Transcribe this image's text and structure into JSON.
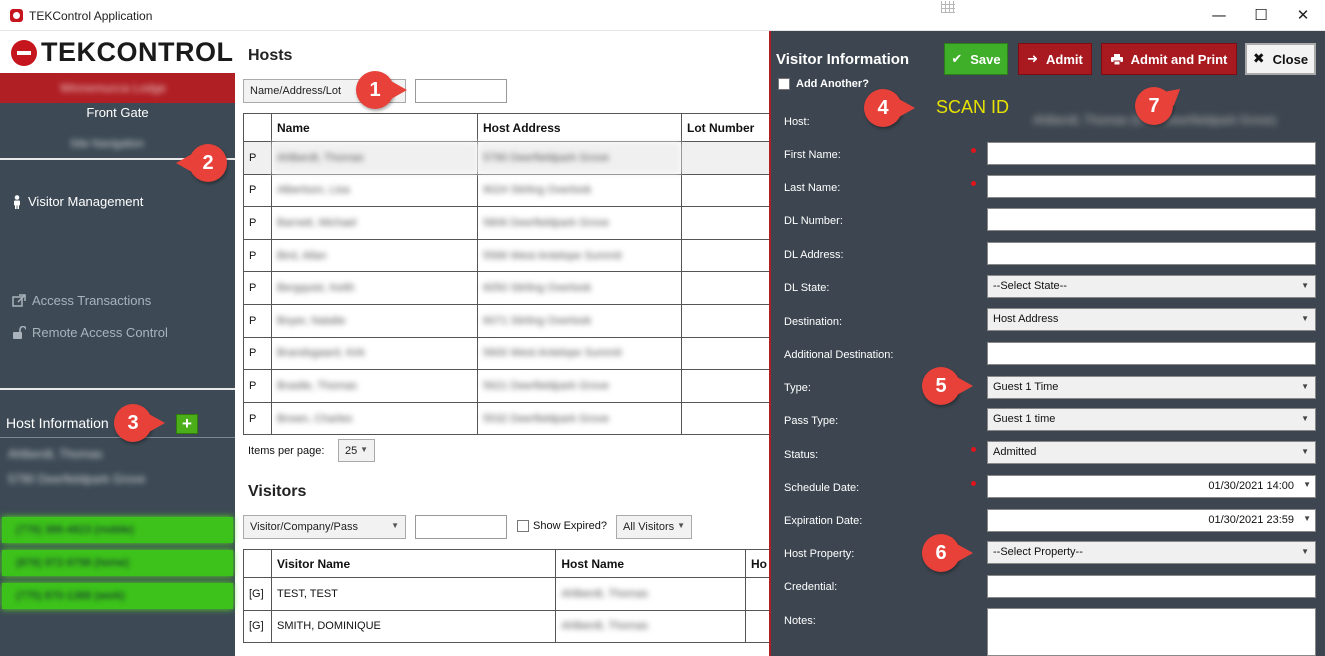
{
  "window": {
    "title": "TEKControl Application",
    "minimize": "—",
    "maximize": "☐",
    "close": "✕"
  },
  "sidebar": {
    "logo": "TEKCONTROL",
    "user_name": "Winnemucca Lodge",
    "location": "Front Gate",
    "sub_location": "Site Navigation",
    "nav": {
      "visitor_management": "Visitor Management",
      "access_transactions": "Access Transactions",
      "remote_access_control": "Remote Access Control"
    },
    "host_information": "Host Information",
    "host_name": "Ahlberdt, Thomas",
    "host_address": "5790 Deerfieldpark Grove",
    "phones": [
      "(776) 386-4823 (mobile)",
      "(876) 972-9798 (home)",
      "(775) 870-1388 (work)"
    ]
  },
  "hosts": {
    "title": "Hosts",
    "filter": "Name/Address/Lot",
    "filter_value": "",
    "columns": [
      "",
      "Name",
      "Host Address",
      "Lot Number"
    ],
    "rows": [
      {
        "type": "P",
        "name": "Ahlberdt, Thomas",
        "address": "5790 Deerfieldpark Grove",
        "lot": ""
      },
      {
        "type": "P",
        "name": "Albertson, Lisa",
        "address": "9024 Stirling Overlook",
        "lot": ""
      },
      {
        "type": "P",
        "name": "Barnett, Michael",
        "address": "5806 Deerfieldpark Grove",
        "lot": ""
      },
      {
        "type": "P",
        "name": "Bird, Allan",
        "address": "5566 West Antelope Summit",
        "lot": ""
      },
      {
        "type": "P",
        "name": "Bergquist, Keith",
        "address": "6050 Stirling Overlook",
        "lot": ""
      },
      {
        "type": "P",
        "name": "Boyer, Natalie",
        "address": "6071 Stirling Overlook",
        "lot": ""
      },
      {
        "type": "P",
        "name": "Brandsgaard, Kirk",
        "address": "5600 West Antelope Summit",
        "lot": ""
      },
      {
        "type": "P",
        "name": "Brastle, Thomas",
        "address": "5621 Deerfieldpark Grove",
        "lot": ""
      },
      {
        "type": "P",
        "name": "Brown, Charles",
        "address": "5532 Deerfieldpark Grove",
        "lot": ""
      }
    ],
    "items_per_page_label": "Items per page:",
    "items_per_page": "25"
  },
  "visitors": {
    "title": "Visitors",
    "filter": "Visitor/Company/Pass",
    "filter_value": "",
    "show_expired": "Show Expired?",
    "scope": "All Visitors",
    "columns": [
      "",
      "Visitor Name",
      "Host Name",
      "Ho"
    ],
    "rows": [
      {
        "type": "[G]",
        "name": "TEST, TEST",
        "host": "Ahlberdt, Thomas"
      },
      {
        "type": "[G]",
        "name": "SMITH, DOMINIQUE",
        "host": "Ahlberdt, Thomas"
      }
    ]
  },
  "visitor_panel": {
    "title": "Visitor Information",
    "buttons": {
      "save": "Save",
      "admit": "Admit",
      "admit_print": "Admit and Print",
      "close": "Close"
    },
    "add_another": "Add Another?",
    "scan_id": "SCAN ID",
    "host_label": "Host:",
    "host_value": "Ahlberdt, Thomas (5790 Deerfieldpark Grove)",
    "fields": {
      "first_name": {
        "label": "First Name:",
        "value": ""
      },
      "last_name": {
        "label": "Last Name:",
        "value": ""
      },
      "dl_number": {
        "label": "DL Number:",
        "value": ""
      },
      "dl_address": {
        "label": "DL Address:",
        "value": ""
      },
      "dl_state": {
        "label": "DL State:",
        "value": "--Select State--"
      },
      "destination": {
        "label": "Destination:",
        "value": "Host Address"
      },
      "additional_destination": {
        "label": "Additional Destination:",
        "value": ""
      },
      "type": {
        "label": "Type:",
        "value": "Guest 1 Time"
      },
      "pass_type": {
        "label": "Pass Type:",
        "value": "Guest 1 time"
      },
      "status": {
        "label": "Status:",
        "value": "Admitted"
      },
      "schedule_date": {
        "label": "Schedule Date:",
        "value": "01/30/2021 14:00"
      },
      "expiration_date": {
        "label": "Expiration Date:",
        "value": "01/30/2021 23:59"
      },
      "host_property": {
        "label": "Host Property:",
        "value": "--Select Property--"
      },
      "credential": {
        "label": "Credential:",
        "value": ""
      },
      "notes": {
        "label": "Notes:",
        "value": ""
      }
    }
  },
  "callouts": [
    "1",
    "2",
    "3",
    "4",
    "5",
    "6",
    "7"
  ],
  "colors": {
    "brand_red": "#b01f24",
    "sidebar": "#3d4a55",
    "save_green": "#3fae29",
    "callout": "#e8413a",
    "scan_yellow": "#e8e200"
  }
}
